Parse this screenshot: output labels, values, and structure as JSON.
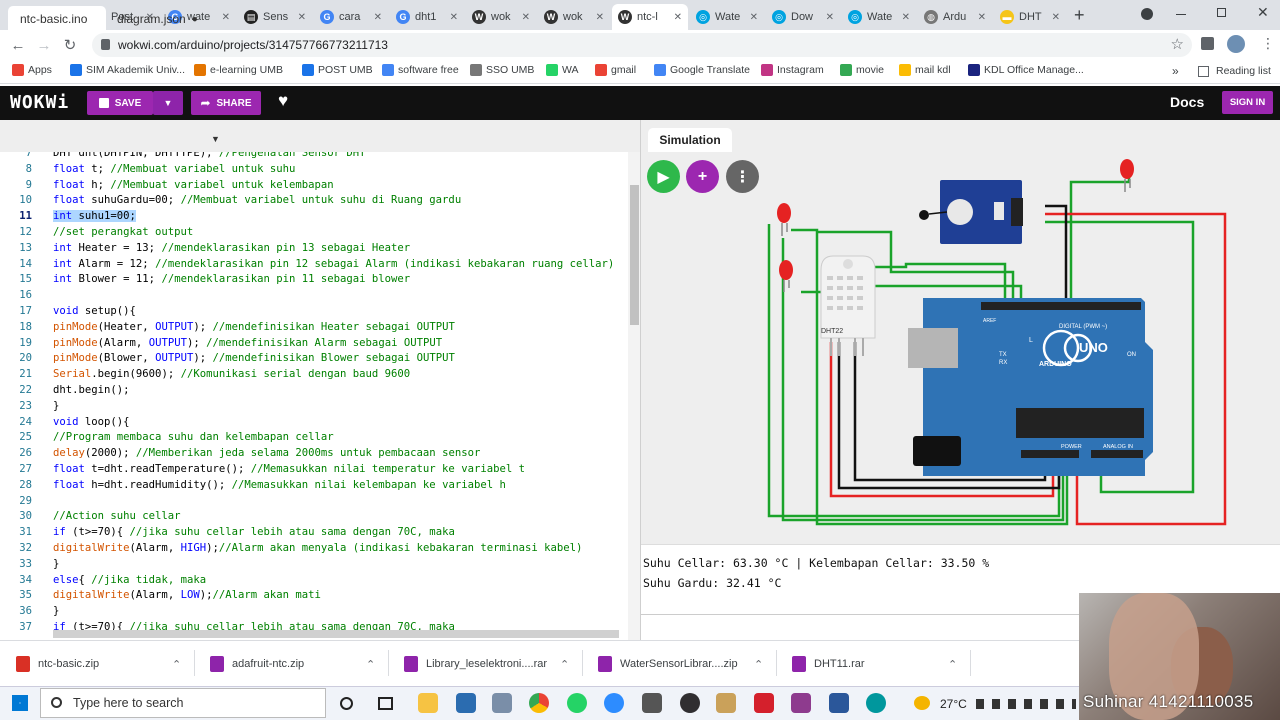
{
  "browser": {
    "tabs": [
      {
        "label": "(90) \\",
        "icon": "whatsapp-icon",
        "color": "#25d366",
        "glyph": "◉"
      },
      {
        "label": "Post",
        "icon": "zoom-icon",
        "color": "#2d8cff",
        "glyph": "■"
      },
      {
        "label": "wate",
        "icon": "google-icon",
        "color": "#4285f4",
        "glyph": "G"
      },
      {
        "label": "Sens",
        "icon": "doc-icon",
        "color": "#222222",
        "glyph": "▤"
      },
      {
        "label": "cara",
        "icon": "google-icon",
        "color": "#4285f4",
        "glyph": "G"
      },
      {
        "label": "dht1",
        "icon": "google-icon",
        "color": "#4285f4",
        "glyph": "G"
      },
      {
        "label": "wok",
        "icon": "wikipedia-icon",
        "color": "#333333",
        "glyph": "W"
      },
      {
        "label": "wok",
        "icon": "wikipedia-icon",
        "color": "#333333",
        "glyph": "W"
      },
      {
        "label": "ntc-l",
        "icon": "wokwi-icon",
        "color": "#333333",
        "glyph": "W"
      },
      {
        "label": "Wate",
        "icon": "site-icon",
        "color": "#00a3e0",
        "glyph": "◎"
      },
      {
        "label": "Dow",
        "icon": "site-icon",
        "color": "#00a3e0",
        "glyph": "◎"
      },
      {
        "label": "Wate",
        "icon": "site-icon",
        "color": "#00a3e0",
        "glyph": "◎"
      },
      {
        "label": "Ardu",
        "icon": "globe-icon",
        "color": "#777777",
        "glyph": "◍"
      },
      {
        "label": "DHT",
        "icon": "folder-icon",
        "color": "#f5c518",
        "glyph": "▬"
      }
    ],
    "new_tab": "+",
    "url": "wokwi.com/arduino/projects/314757766773211713",
    "bookmarks": [
      {
        "label": "Apps",
        "color": "#ea4335"
      },
      {
        "label": "SIM Akademik Univ...",
        "color": "#1a73e8"
      },
      {
        "label": "e-learning UMB",
        "color": "#e37400"
      },
      {
        "label": "POST UMB",
        "color": "#1a73e8"
      },
      {
        "label": "software free",
        "color": "#4285f4"
      },
      {
        "label": "SSO UMB",
        "color": "#777777"
      },
      {
        "label": "WA",
        "color": "#25d366"
      },
      {
        "label": "gmail",
        "color": "#ea4335"
      },
      {
        "label": "Google Translate",
        "color": "#4285f4"
      },
      {
        "label": "Instagram",
        "color": "#c13584"
      },
      {
        "label": "movie",
        "color": "#34a853"
      },
      {
        "label": "mail kdl",
        "color": "#fbbc04"
      },
      {
        "label": "KDL Office Manage...",
        "color": "#1a237e"
      }
    ],
    "more_bookmarks": "»",
    "reading_list": "Reading list"
  },
  "wokwi": {
    "logo": "WOKWi",
    "save": "SAVE",
    "share": "SHARE",
    "docs": "Docs",
    "signin": "SIGN IN",
    "editor_tabs": [
      "ntc-basic.ino",
      "diagram.json"
    ],
    "modified_dot": "●",
    "sim_tab": "Simulation"
  },
  "code_lines": [
    {
      "n": "7",
      "t": "DHT dht(DHTPIN, DHTTYPE); //Pengenalan Sensor DHT"
    },
    {
      "n": "8",
      "t": "float t; //Membuat variabel untuk suhu"
    },
    {
      "n": "9",
      "t": "float h; //Membuat variabel untuk kelembapan"
    },
    {
      "n": "10",
      "t": "float suhuGardu=00; //Membuat variabel untuk suhu di Ruang gardu"
    },
    {
      "n": "11",
      "t": "int suhu1=00;"
    },
    {
      "n": "12",
      "t": "//set perangkat output"
    },
    {
      "n": "13",
      "t": "int Heater = 13; //mendeklarasikan pin 13 sebagai Heater"
    },
    {
      "n": "14",
      "t": "int Alarm = 12; //mendeklarasikan pin 12 sebagai Alarm (indikasi kebakaran ruang cellar)"
    },
    {
      "n": "15",
      "t": "int Blower = 11; //mendeklarasikan pin 11 sebagai blower"
    },
    {
      "n": "16",
      "t": ""
    },
    {
      "n": "17",
      "t": "void setup(){"
    },
    {
      "n": "18",
      "t": "pinMode(Heater, OUTPUT); //mendefinisikan Heater sebagai OUTPUT"
    },
    {
      "n": "19",
      "t": "pinMode(Alarm, OUTPUT); //mendefinisikan Alarm sebagai OUTPUT"
    },
    {
      "n": "20",
      "t": "pinMode(Blower, OUTPUT); //mendefinisikan Blower sebagai OUTPUT"
    },
    {
      "n": "21",
      "t": "Serial.begin(9600); //Komunikasi serial dengan baud 9600"
    },
    {
      "n": "22",
      "t": "dht.begin();"
    },
    {
      "n": "23",
      "t": "}"
    },
    {
      "n": "24",
      "t": "void loop(){"
    },
    {
      "n": "25",
      "t": "//Program membaca suhu dan kelembapan cellar"
    },
    {
      "n": "26",
      "t": "delay(2000); //Memberikan jeda selama 2000ms untuk pembacaan sensor"
    },
    {
      "n": "27",
      "t": "float t=dht.readTemperature(); //Memasukkan nilai temperatur ke variabel t"
    },
    {
      "n": "28",
      "t": "float h=dht.readHumidity(); //Memasukkan nilai kelembapan ke variabel h"
    },
    {
      "n": "29",
      "t": ""
    },
    {
      "n": "30",
      "t": "//Action suhu cellar"
    },
    {
      "n": "31",
      "t": "if (t>=70){ //jika suhu cellar lebih atau sama dengan 70C, maka"
    },
    {
      "n": "32",
      "t": "digitalWrite(Alarm, HIGH);//Alarm akan menyala (indikasi kebakaran terminasi kabel)"
    },
    {
      "n": "33",
      "t": "}"
    },
    {
      "n": "34",
      "t": "else{ //jika tidak, maka"
    },
    {
      "n": "35",
      "t": "digitalWrite(Alarm, LOW);//Alarm akan mati"
    },
    {
      "n": "36",
      "t": "}"
    },
    {
      "n": "37",
      "t": "if (t>=70){ //jika suhu cellar lebih atau sama dengan 70C, maka"
    }
  ],
  "simulation": {
    "dht_label": "DHT22",
    "board_labels": {
      "uno": "UNO",
      "arduino": "ARDUINO",
      "digital": "DIGITAL (PWM ~)",
      "power": "POWER",
      "analog": "ANALOG IN",
      "on": "ON",
      "tx": "TX",
      "rx": "RX",
      "l": "L",
      "aref": "AREF"
    },
    "serial_lines": [
      "Suhu Cellar: 63.30 °C | Kelembapan Cellar: 33.50 %",
      "Suhu Gardu: 32.41 °C"
    ]
  },
  "downloads": [
    {
      "label": "ntc-basic.zip",
      "color": "#d93025"
    },
    {
      "label": "adafruit-ntc.zip",
      "color": "#8e24aa"
    },
    {
      "label": "Library_leselektroni....rar",
      "color": "#8e24aa"
    },
    {
      "label": "WaterSensorLibrar....zip",
      "color": "#8e24aa"
    },
    {
      "label": "DHT11.rar",
      "color": "#8e24aa"
    }
  ],
  "taskbar": {
    "search_placeholder": "Type here to search",
    "weather": "27°C"
  },
  "webcam_caption": "Suhinar  41421110035"
}
